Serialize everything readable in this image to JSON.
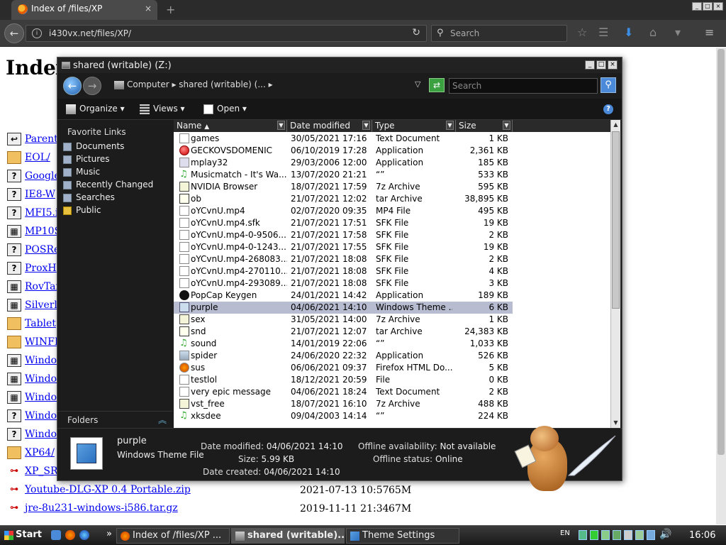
{
  "browser": {
    "tab_title": "Index of /files/XP",
    "tab_close": "×",
    "new_tab": "+",
    "url": "i430vx.net/files/XP/",
    "search_placeholder": "Search",
    "window_controls": [
      "_",
      "□",
      "×"
    ]
  },
  "page": {
    "heading": "Index",
    "links": [
      {
        "text": "Parent",
        "icon": "back-arrow-icon"
      },
      {
        "text": "EOL/",
        "icon": "folder-icon"
      },
      {
        "text": "Google",
        "icon": "unknown-file-icon"
      },
      {
        "text": "IE8-W",
        "icon": "unknown-file-icon"
      },
      {
        "text": "MFI5.i",
        "icon": "unknown-file-icon"
      },
      {
        "text": "MP10S",
        "icon": "binary-file-icon"
      },
      {
        "text": "POSRe",
        "icon": "unknown-file-icon"
      },
      {
        "text": "ProxH",
        "icon": "unknown-file-icon"
      },
      {
        "text": "RovTar",
        "icon": "binary-file-icon"
      },
      {
        "text": "Silverli",
        "icon": "binary-file-icon"
      },
      {
        "text": "Tablet",
        "icon": "folder-icon"
      },
      {
        "text": "WINFI",
        "icon": "folder-icon"
      },
      {
        "text": "Window",
        "icon": "binary-file-icon"
      },
      {
        "text": "Window",
        "icon": "binary-file-icon"
      },
      {
        "text": "Window",
        "icon": "binary-file-icon"
      },
      {
        "text": "Window",
        "icon": "unknown-file-icon"
      },
      {
        "text": "Window",
        "icon": "unknown-file-icon"
      },
      {
        "text": "XP64/",
        "icon": "folder-icon"
      },
      {
        "text": "XP_SR",
        "icon": "compressed-file-icon"
      },
      {
        "text": "Youtube-DLG-XP 0.4 Portable.zip",
        "icon": "compressed-file-icon",
        "date": "2021-07-13 10:57",
        "size": "65M"
      },
      {
        "text": "jre-8u231-windows-i586.tar.gz",
        "icon": "compressed-file-icon",
        "date": "2019-11-11 21:34",
        "size": "67M"
      }
    ]
  },
  "explorer": {
    "title": "shared (writable) (Z:)",
    "breadcrumb": "Computer ▸ shared (writable) (... ▸",
    "search_placeholder": "Search",
    "toolbar": {
      "organize": "Organize",
      "views": "Views",
      "open": "Open"
    },
    "favorites_title": "Favorite Links",
    "favorites": [
      "Documents",
      "Pictures",
      "Music",
      "Recently Changed",
      "Searches",
      "Public"
    ],
    "folders_label": "Folders",
    "columns": {
      "name": "Name",
      "date": "Date modified",
      "type": "Type",
      "size": "Size"
    },
    "files": [
      {
        "name": "games",
        "date": "30/05/2021 17:16",
        "type": "Text Document",
        "size": "1 KB",
        "icon": "text-file-icon"
      },
      {
        "name": "GECKOVSDOMENIC",
        "date": "06/10/2019 17:28",
        "type": "Application",
        "size": "2,361 KB",
        "icon": "red-app-icon"
      },
      {
        "name": "mplay32",
        "date": "29/03/2006 12:00",
        "type": "Application",
        "size": "185 KB",
        "icon": "app-icon"
      },
      {
        "name": "Musicmatch - It's Wa...",
        "date": "13/07/2020 21:21",
        "type": "“”",
        "size": "533 KB",
        "icon": "music-file-icon"
      },
      {
        "name": "NVIDIA Browser",
        "date": "18/07/2021 17:59",
        "type": "7z Archive",
        "size": "595 KB",
        "icon": "archive-icon"
      },
      {
        "name": "ob",
        "date": "21/07/2021 12:02",
        "type": "tar Archive",
        "size": "38,895 KB",
        "icon": "tar-icon"
      },
      {
        "name": "oYCvnU.mp4",
        "date": "02/07/2020 09:35",
        "type": "MP4 File",
        "size": "495 KB",
        "icon": "file-icon"
      },
      {
        "name": "oYCvnU.mp4.sfk",
        "date": "21/07/2021 17:51",
        "type": "SFK File",
        "size": "19 KB",
        "icon": "file-icon"
      },
      {
        "name": "oYCvnU.mp4-0-9506...",
        "date": "21/07/2021 17:58",
        "type": "SFK File",
        "size": "2 KB",
        "icon": "file-icon"
      },
      {
        "name": "oYCvnU.mp4-0-1243...",
        "date": "21/07/2021 17:55",
        "type": "SFK File",
        "size": "19 KB",
        "icon": "file-icon"
      },
      {
        "name": "oYCvnU.mp4-268083...",
        "date": "21/07/2021 18:08",
        "type": "SFK File",
        "size": "2 KB",
        "icon": "file-icon"
      },
      {
        "name": "oYCvnU.mp4-270110...",
        "date": "21/07/2021 18:08",
        "type": "SFK File",
        "size": "4 KB",
        "icon": "file-icon"
      },
      {
        "name": "oYCvnU.mp4-293089...",
        "date": "21/07/2021 18:08",
        "type": "SFK File",
        "size": "3 KB",
        "icon": "file-icon"
      },
      {
        "name": "PopCap Keygen",
        "date": "24/01/2021 14:42",
        "type": "Application",
        "size": "189 KB",
        "icon": "popcap-icon"
      },
      {
        "name": "purple",
        "date": "04/06/2021 14:10",
        "type": "Windows Theme ...",
        "size": "6 KB",
        "icon": "theme-file-icon",
        "selected": true
      },
      {
        "name": "sex",
        "date": "31/05/2021 14:00",
        "type": "7z Archive",
        "size": "1 KB",
        "icon": "archive-icon"
      },
      {
        "name": "snd",
        "date": "21/07/2021 12:07",
        "type": "tar Archive",
        "size": "24,383 KB",
        "icon": "tar-icon"
      },
      {
        "name": "sound",
        "date": "14/01/2019 22:06",
        "type": "“”",
        "size": "1,033 KB",
        "icon": "music-file-icon"
      },
      {
        "name": "spider",
        "date": "24/06/2020 22:32",
        "type": "Application",
        "size": "526 KB",
        "icon": "spider-app-icon"
      },
      {
        "name": "sus",
        "date": "06/06/2021 09:37",
        "type": "Firefox HTML Do...",
        "size": "5 KB",
        "icon": "firefox-html-icon"
      },
      {
        "name": "testlol",
        "date": "18/12/2021 20:59",
        "type": "File",
        "size": "0 KB",
        "icon": "file-icon"
      },
      {
        "name": "very epic message",
        "date": "04/06/2021 18:24",
        "type": "Text Document",
        "size": "2 KB",
        "icon": "text-file-icon"
      },
      {
        "name": "vst_free",
        "date": "18/07/2021 16:10",
        "type": "7z Archive",
        "size": "488 KB",
        "icon": "archive-icon"
      },
      {
        "name": "xksdee",
        "date": "09/04/2003 14:14",
        "type": "“”",
        "size": "224 KB",
        "icon": "music-file-icon"
      }
    ],
    "details": {
      "name": "purple",
      "type": "Windows Theme File",
      "modified_label": "Date modified:",
      "modified": "04/06/2021 14:10",
      "size_label": "Size:",
      "size": "5.99 KB",
      "created_label": "Date created:",
      "created": "04/06/2021 14:10",
      "offline_avail_label": "Offline availability:",
      "offline_avail": "Not available",
      "offline_status_label": "Offline status:",
      "offline_status": "Online"
    }
  },
  "taskbar": {
    "start": "Start",
    "overflow": "»",
    "tasks": [
      {
        "label": "Index of /files/XP ...",
        "active": false
      },
      {
        "label": "shared (writable)...",
        "active": true
      },
      {
        "label": "Theme Settings",
        "active": false
      }
    ],
    "lang": "EN",
    "clock": "16:06"
  },
  "colors": {
    "selection": "#b8bcd0",
    "explorer_bg": "#1c1c1c",
    "link": "#0000ee"
  }
}
